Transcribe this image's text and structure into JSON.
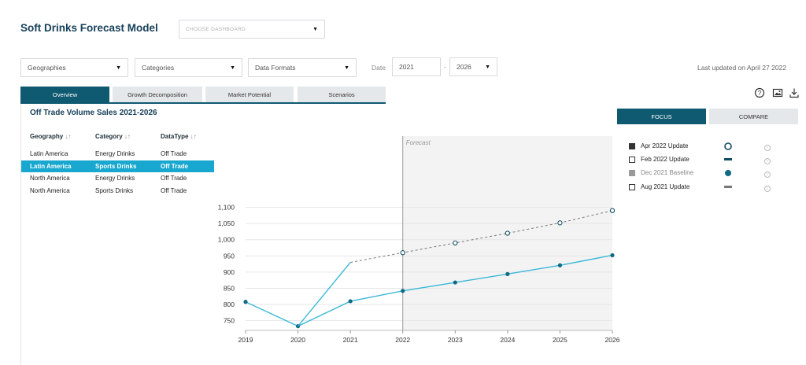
{
  "header": {
    "title": "Soft Drinks Forecast Model",
    "dashboard_placeholder": "CHOOSE DASHBOARD"
  },
  "filters": {
    "geographies": "Geographies",
    "categories": "Categories",
    "data_formats": "Data Formats",
    "date_label": "Date",
    "date_from": "2021",
    "date_sep": "-",
    "date_to": "2026",
    "last_updated": "Last updated on April 27 2022"
  },
  "tabs": [
    {
      "label": "Overview",
      "active": true
    },
    {
      "label": "Growth Decomposition",
      "active": false
    },
    {
      "label": "Market Potential",
      "active": false
    },
    {
      "label": "Scenarios",
      "active": false
    }
  ],
  "toolbar_icons": [
    "help-icon",
    "image-icon",
    "download-icon"
  ],
  "panel": {
    "title": "Off Trade Volume Sales 2021-2026",
    "columns": [
      "Geography",
      "Category",
      "DataType"
    ],
    "rows": [
      {
        "geography": "Latin America",
        "category": "Energy Drinks",
        "datatype": "Off Trade",
        "selected": false
      },
      {
        "geography": "Latin America",
        "category": "Sports Drinks",
        "datatype": "Off Trade",
        "selected": true
      },
      {
        "geography": "North America",
        "category": "Energy Drinks",
        "datatype": "Off Trade",
        "selected": false
      },
      {
        "geography": "North America",
        "category": "Sports Drinks",
        "datatype": "Off Trade",
        "selected": false
      }
    ]
  },
  "view_tabs": {
    "focus": "FOCUS",
    "compare": "COMPARE",
    "active": "focus"
  },
  "legend": [
    {
      "label": "Apr 2022 Update",
      "checked": true,
      "marker": "open-circle",
      "info": "i"
    },
    {
      "label": "Feb 2022 Update",
      "checked": false,
      "marker": "dash",
      "info": "i"
    },
    {
      "label": "Dec 2021 Baseline",
      "checked": "grey",
      "marker": "filled-circle",
      "info": "i"
    },
    {
      "label": "Aug 2021 Update",
      "checked": false,
      "marker": "dash-grey",
      "info": "i"
    }
  ],
  "colors": {
    "primary": "#0f5a70",
    "accent": "#17a7cf",
    "series_line": "#3bb8d6",
    "dashed_line": "#777777",
    "forecast_bg": "#f3f3f3"
  },
  "chart_data": {
    "type": "line",
    "annotation": "Forecast",
    "forecast_start": 2022,
    "x": [
      2019,
      2020,
      2021,
      2022,
      2023,
      2024,
      2025,
      2026
    ],
    "ylim": [
      720,
      1320
    ],
    "yticks": [
      750,
      800,
      850,
      900,
      950,
      1000,
      1050,
      1100
    ],
    "ytick_labels": [
      "750",
      "800",
      "850",
      "900",
      "950",
      "1,000",
      "1,050",
      "1,100"
    ],
    "series": [
      {
        "x": [
          2019,
          2020,
          2021,
          2022,
          2023,
          2024,
          2025,
          2026
        ],
        "values": [
          808,
          733,
          810,
          842,
          868,
          894,
          921,
          952
        ],
        "style": "solid-filled"
      },
      {
        "x": [
          2020,
          2021
        ],
        "values": [
          733,
          930
        ],
        "style": "solid"
      },
      {
        "x": [
          2021,
          2022,
          2023,
          2024,
          2025,
          2026
        ],
        "values": [
          930,
          960,
          990,
          1020,
          1052,
          1090
        ],
        "style": "dashed-open"
      }
    ]
  }
}
